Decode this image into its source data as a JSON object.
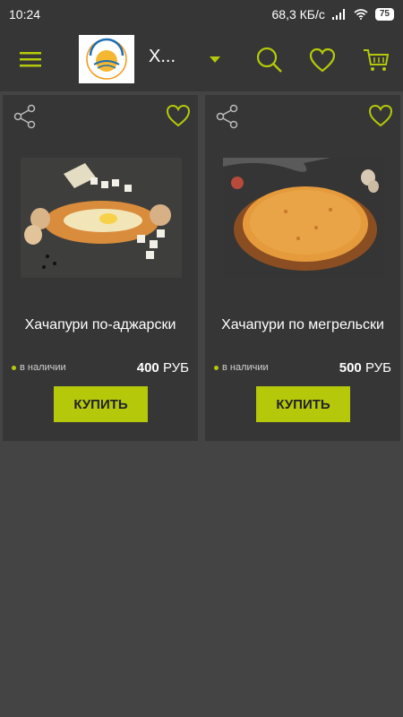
{
  "status_bar": {
    "time": "10:24",
    "network_speed": "68,3 КБ/с",
    "battery": "75",
    "icons": [
      "signal-icon",
      "wifi-icon",
      "battery-icon"
    ]
  },
  "header": {
    "store_name": "Х...",
    "logo_label": "Солнечная Трапеза",
    "icons": [
      "menu-icon",
      "chevron-down-icon",
      "search-icon",
      "heart-icon",
      "cart-icon"
    ],
    "accent_color": "#b5c90a"
  },
  "products": [
    {
      "name": "Хачапури по-аджарски",
      "availability": "в наличии",
      "price": "400",
      "currency": "РУБ",
      "buy_label": "КУПИТЬ"
    },
    {
      "name": "Хачапури по мегрельски",
      "availability": "в наличии",
      "price": "500",
      "currency": "РУБ",
      "buy_label": "КУПИТЬ"
    }
  ]
}
